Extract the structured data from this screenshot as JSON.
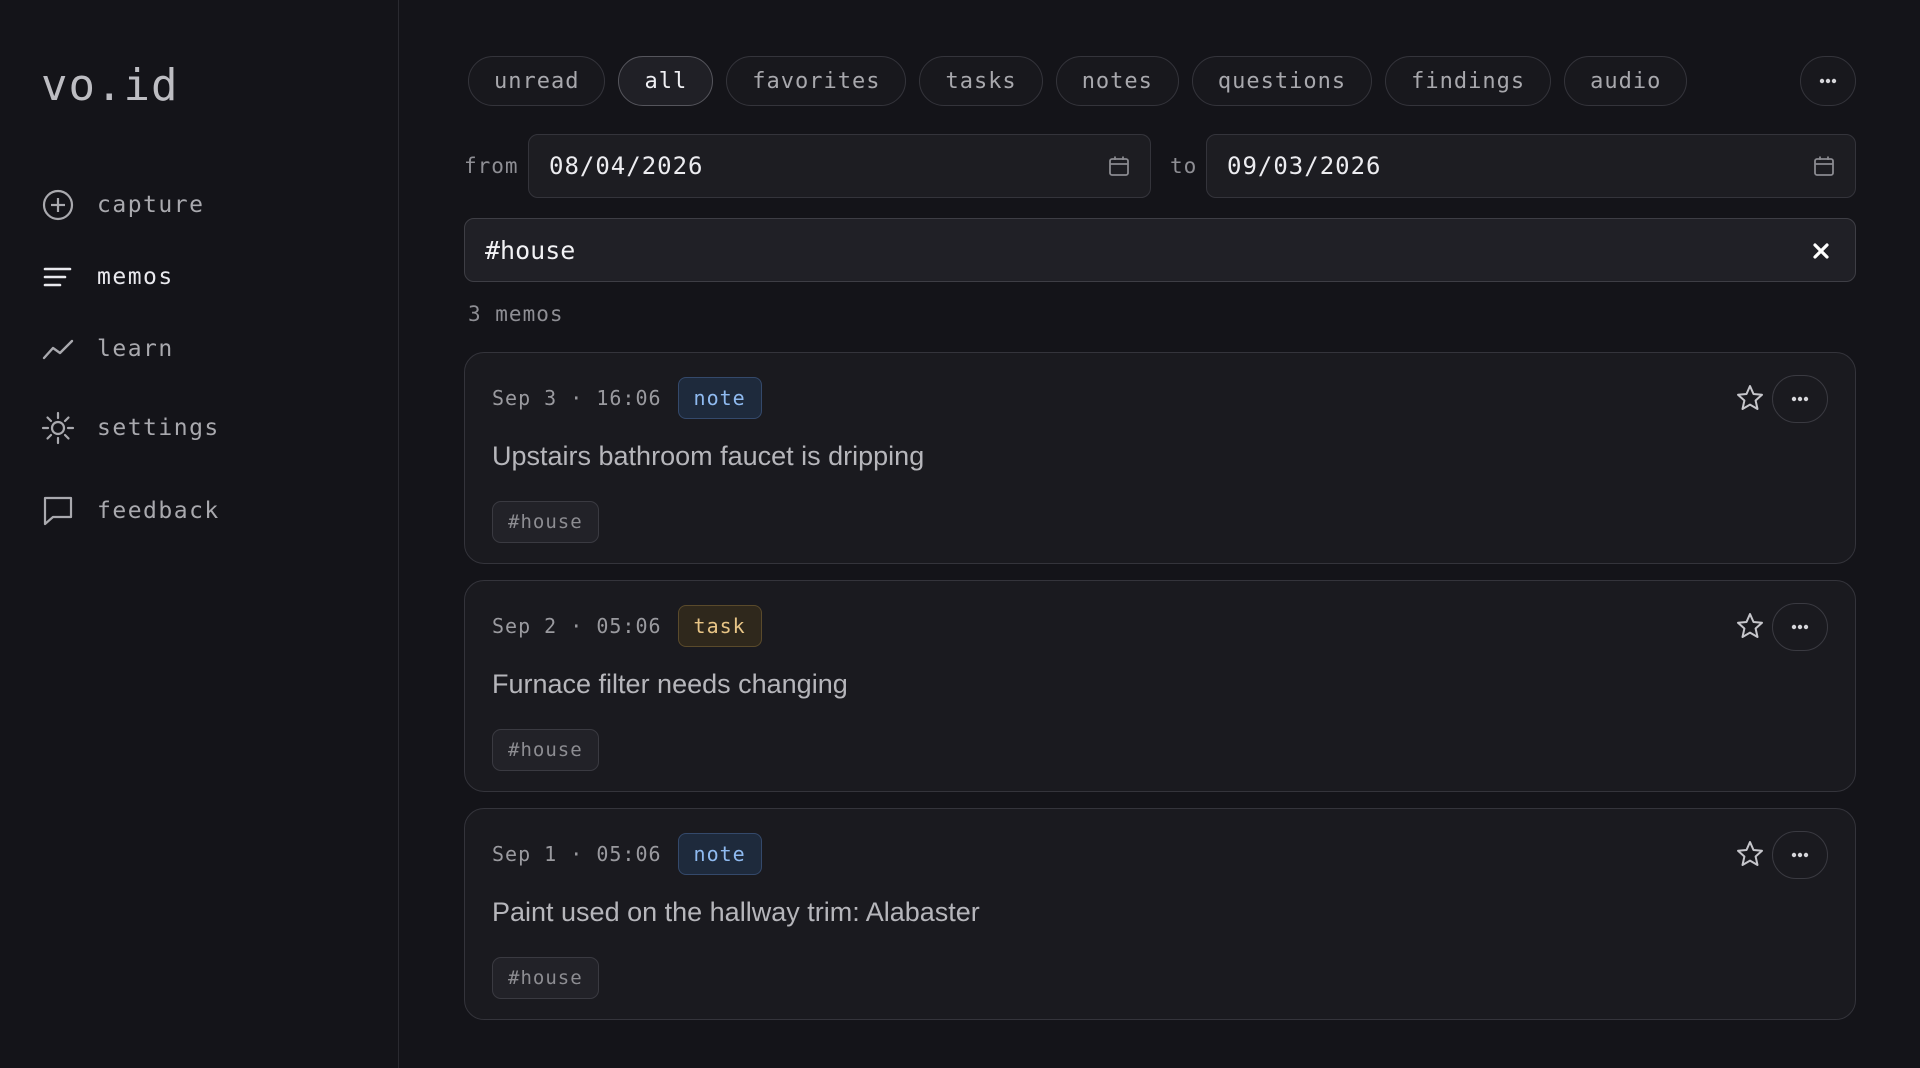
{
  "app": {
    "logo": "vo.id"
  },
  "sidebar": {
    "items": [
      {
        "label": "capture",
        "icon": "plus-circle-icon",
        "active": false
      },
      {
        "label": "memos",
        "icon": "list-icon",
        "active": true
      },
      {
        "label": "learn",
        "icon": "trend-icon",
        "active": false
      },
      {
        "label": "settings",
        "icon": "gear-icon",
        "active": false
      },
      {
        "label": "feedback",
        "icon": "chat-icon",
        "active": false
      }
    ]
  },
  "filters": {
    "chips": [
      {
        "label": "unread"
      },
      {
        "label": "all",
        "active": true
      },
      {
        "label": "favorites"
      },
      {
        "label": "tasks"
      },
      {
        "label": "notes"
      },
      {
        "label": "questions"
      },
      {
        "label": "findings"
      },
      {
        "label": "audio"
      }
    ],
    "more_icon": "ellipsis-icon"
  },
  "dates": {
    "from_label": "from",
    "from_value": "08/04/2026",
    "to_label": "to",
    "to_value": "09/03/2026"
  },
  "search": {
    "value": "#house"
  },
  "count": "3 memos",
  "memos": [
    {
      "time": "Sep 3 · 16:06",
      "type": "note",
      "text": "Upstairs bathroom faucet is dripping",
      "tag": "#house"
    },
    {
      "time": "Sep 2 · 05:06",
      "type": "task",
      "text": "Furnace filter needs changing",
      "tag": "#house"
    },
    {
      "time": "Sep 1 · 05:06",
      "type": "note",
      "text": "Paint used on the hallway trim: Alabaster",
      "tag": "#house"
    }
  ],
  "colors": {
    "background": "#141419",
    "note_badge": "#8fbaf0",
    "task_badge": "#e8c586"
  }
}
